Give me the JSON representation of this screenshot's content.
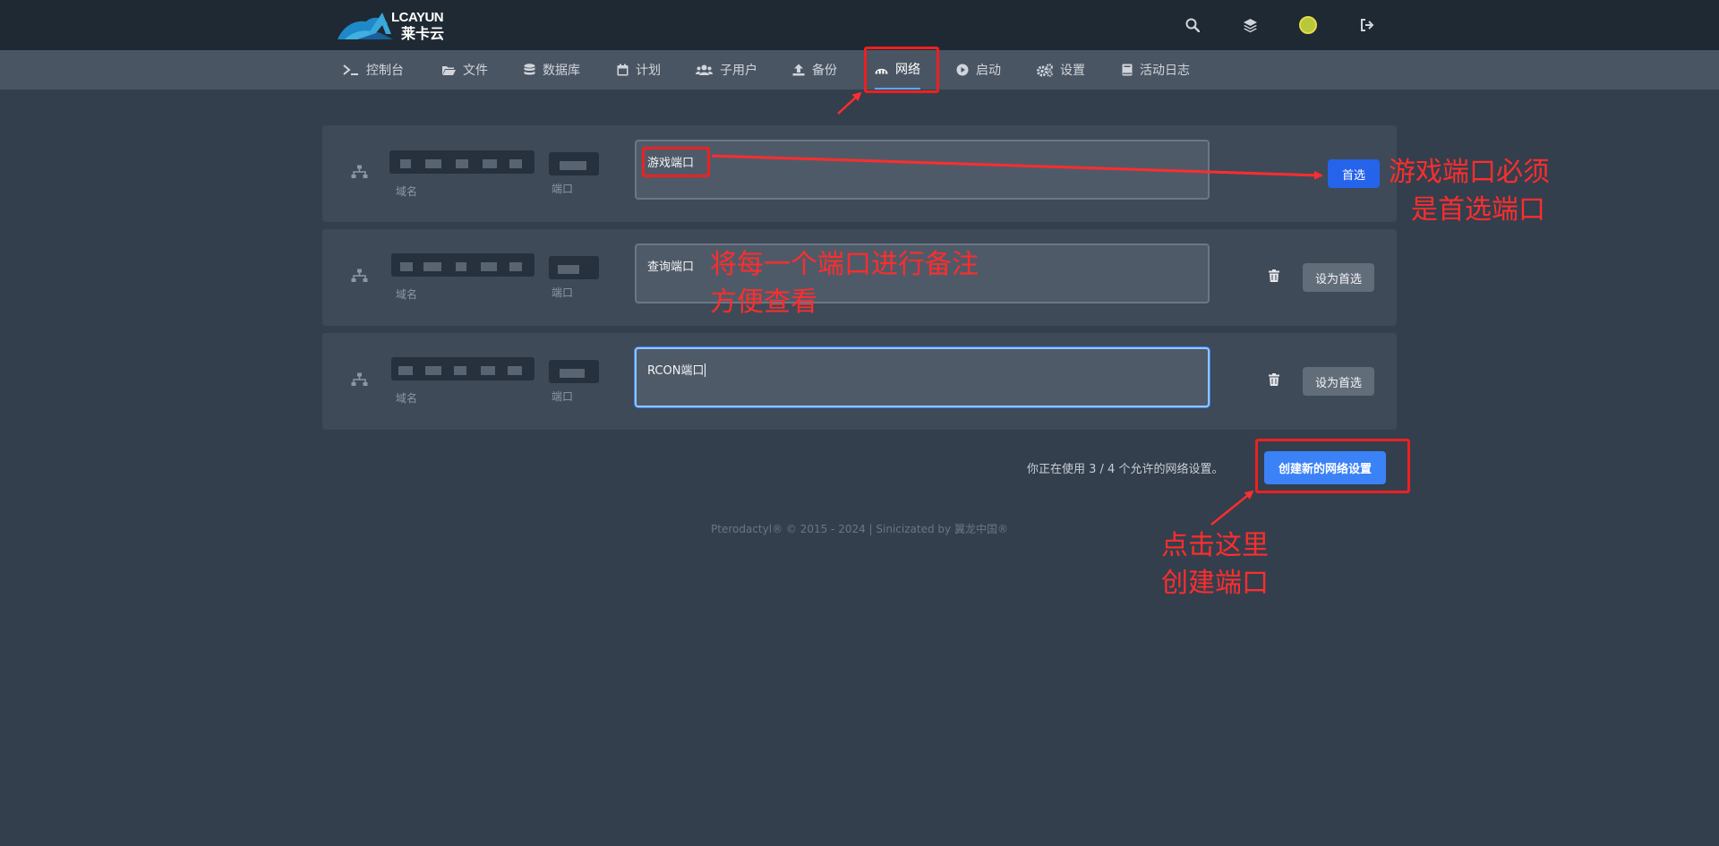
{
  "brand": {
    "line1": "LCAYUN",
    "line2": "莱卡云"
  },
  "top_icons": [
    "search-icon",
    "layers-icon",
    "avatar",
    "logout-icon"
  ],
  "nav": {
    "tabs": [
      {
        "label": "控制台",
        "icon": "terminal-icon"
      },
      {
        "label": "文件",
        "icon": "folder-icon"
      },
      {
        "label": "数据库",
        "icon": "database-icon"
      },
      {
        "label": "计划",
        "icon": "calendar-icon"
      },
      {
        "label": "子用户",
        "icon": "users-icon"
      },
      {
        "label": "备份",
        "icon": "upload-icon"
      },
      {
        "label": "网络",
        "icon": "network-icon",
        "active": true
      },
      {
        "label": "启动",
        "icon": "play-icon"
      },
      {
        "label": "设置",
        "icon": "cogs-icon"
      },
      {
        "label": "活动日志",
        "icon": "book-icon"
      }
    ]
  },
  "allocations": [
    {
      "domain_label": "域名",
      "port_label": "端口",
      "notes": "游戏端口",
      "primary_label": "首选",
      "is_primary": true
    },
    {
      "domain_label": "域名",
      "port_label": "端口",
      "notes": "查询端口",
      "primary_label": "设为首选",
      "is_primary": false
    },
    {
      "domain_label": "域名",
      "port_label": "端口",
      "notes": "RCON端口",
      "primary_label": "设为首选",
      "is_primary": false
    }
  ],
  "usage_text": "你正在使用 3 / 4 个允许的网络设置。",
  "create_button": "创建新的网络设置",
  "footer": "Pterodactyl® © 2015 - 2024 | Sinicizated by 翼龙中国®",
  "annotations": {
    "primary_note_line1": "游戏端口必须",
    "primary_note_line2": "是首选端口",
    "remark_line1": "将每一个端口进行备注",
    "remark_line2": "方便查看",
    "create_line1": "点击这里",
    "create_line2": "创建端口"
  },
  "colors": {
    "accent": "#3b82f6",
    "annotation": "#ff2d2d",
    "background": "#333f4d"
  }
}
